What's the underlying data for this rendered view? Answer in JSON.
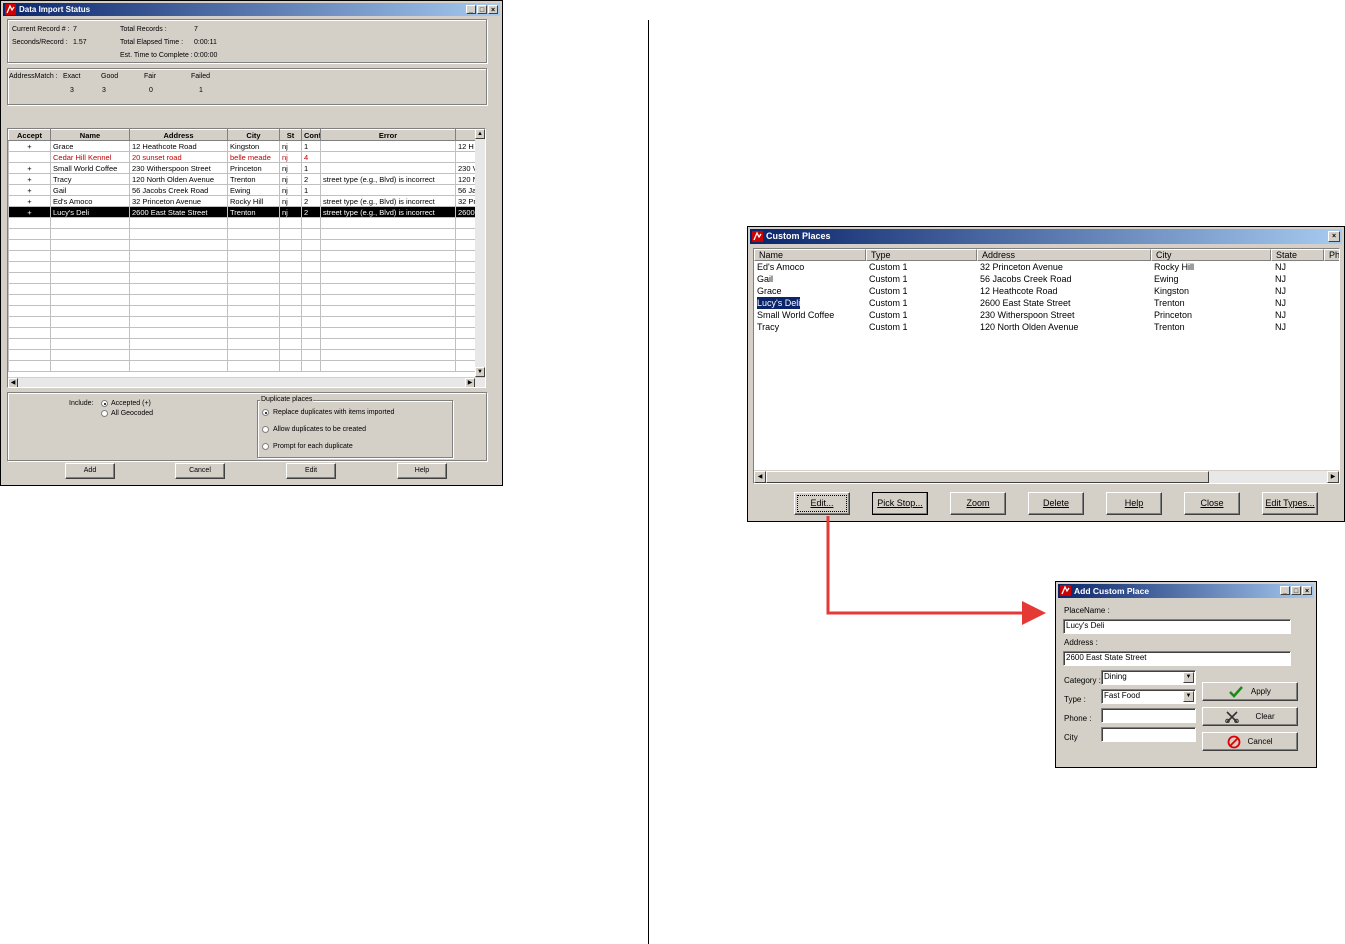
{
  "import_window": {
    "title": "Data Import Status",
    "stats": {
      "current_record_label": "Current Record # :",
      "current_record_value": "7",
      "seconds_label": "Seconds/Record :",
      "seconds_value": "1.57",
      "total_records_label": "Total Records :",
      "total_records_value": "7",
      "elapsed_label": "Total Elapsed Time :",
      "elapsed_value": "0:00:11",
      "est_label": "Est. Time to Complete :",
      "est_value": "0:00:00"
    },
    "match": {
      "label": "AddressMatch :",
      "headers": [
        "Exact",
        "Good",
        "Fair",
        "Failed"
      ],
      "values": [
        "3",
        "3",
        "0",
        "1"
      ]
    },
    "columns": [
      "Accept",
      "Name",
      "Address",
      "City",
      "St",
      "Conf",
      "Error",
      ""
    ],
    "rows": [
      {
        "accept": "+",
        "name": "Grace",
        "address": "12 Heathcote Road",
        "city": "Kingston",
        "st": "nj",
        "conf": "1",
        "error": "",
        "extra": "12 H"
      },
      {
        "accept": "",
        "name": "Cedar Hill Kennel",
        "address": "20 sunset road",
        "city": "belle meade",
        "st": "nj",
        "conf": "4",
        "error": "",
        "extra": ""
      },
      {
        "accept": "+",
        "name": "Small World Coffee",
        "address": "230 Witherspoon Street",
        "city": "Princeton",
        "st": "nj",
        "conf": "1",
        "error": "",
        "extra": "230 V"
      },
      {
        "accept": "+",
        "name": "Tracy",
        "address": "120 North Olden Avenue",
        "city": "Trenton",
        "st": "nj",
        "conf": "2",
        "error": "street type (e.g., Blvd) is incorrect",
        "extra": "120 N"
      },
      {
        "accept": "+",
        "name": "Gail",
        "address": "56 Jacobs Creek Road",
        "city": "Ewing",
        "st": "nj",
        "conf": "1",
        "error": "",
        "extra": "56 Ja"
      },
      {
        "accept": "+",
        "name": "Ed's Amoco",
        "address": "32 Princeton Avenue",
        "city": "Rocky Hill",
        "st": "nj",
        "conf": "2",
        "error": "street type (e.g., Blvd) is incorrect",
        "extra": "32 Pr"
      },
      {
        "accept": "+",
        "name": "Lucy's Deli",
        "address": "2600 East State Street",
        "city": "Trenton",
        "st": "nj",
        "conf": "2",
        "error": "street type (e.g., Blvd) is incorrect",
        "extra": "2600"
      }
    ],
    "include_label": "Include:",
    "include_options": [
      "Accepted (+)",
      "All Geocoded"
    ],
    "duplicate_group_label": "Duplicate places",
    "duplicate_options": [
      "Replace duplicates with items imported",
      "Allow duplicates to be created",
      "Prompt for each duplicate"
    ],
    "buttons": [
      "Add",
      "Cancel",
      "Edit",
      "Help"
    ]
  },
  "custom_places": {
    "title": "Custom Places",
    "columns": [
      "Name",
      "Type",
      "Address",
      "City",
      "State",
      "Ph"
    ],
    "rows": [
      {
        "name": "Ed's Amoco",
        "type": "Custom 1",
        "address": "32 Princeton Avenue",
        "city": "Rocky Hill",
        "state": "NJ"
      },
      {
        "name": "Gail",
        "type": "Custom 1",
        "address": "56 Jacobs Creek Road",
        "city": "Ewing",
        "state": "NJ"
      },
      {
        "name": "Grace",
        "type": "Custom 1",
        "address": "12 Heathcote Road",
        "city": "Kingston",
        "state": "NJ"
      },
      {
        "name": "Lucy's Deli",
        "type": "Custom 1",
        "address": "2600 East State Street",
        "city": "Trenton",
        "state": "NJ"
      },
      {
        "name": "Small World Coffee",
        "type": "Custom 1",
        "address": "230 Witherspoon Street",
        "city": "Princeton",
        "state": "NJ"
      },
      {
        "name": "Tracy",
        "type": "Custom 1",
        "address": "120 North Olden Avenue",
        "city": "Trenton",
        "state": "NJ"
      }
    ],
    "buttons": [
      "Edit...",
      "Pick Stop...",
      "Zoom",
      "Delete",
      "Help",
      "Close",
      "Edit Types..."
    ]
  },
  "add_custom_place": {
    "title": "Add Custom Place",
    "place_name_label": "PlaceName :",
    "place_name_value": "Lucy's Deli",
    "address_label": "Address :",
    "address_value": "2600 East State Street",
    "category_label": "Category :",
    "category_value": "Dining",
    "type_label": "Type :",
    "type_value": "Fast Food",
    "phone_label": "Phone :",
    "phone_value": "",
    "city_label": "City",
    "city_value": "",
    "apply_label": "Apply",
    "clear_label": "Clear",
    "cancel_label": "Cancel"
  },
  "colors": {
    "arrow": "#e53935",
    "title_start": "#0a246a",
    "title_end": "#a6caf0",
    "error_row": "#c00000"
  }
}
